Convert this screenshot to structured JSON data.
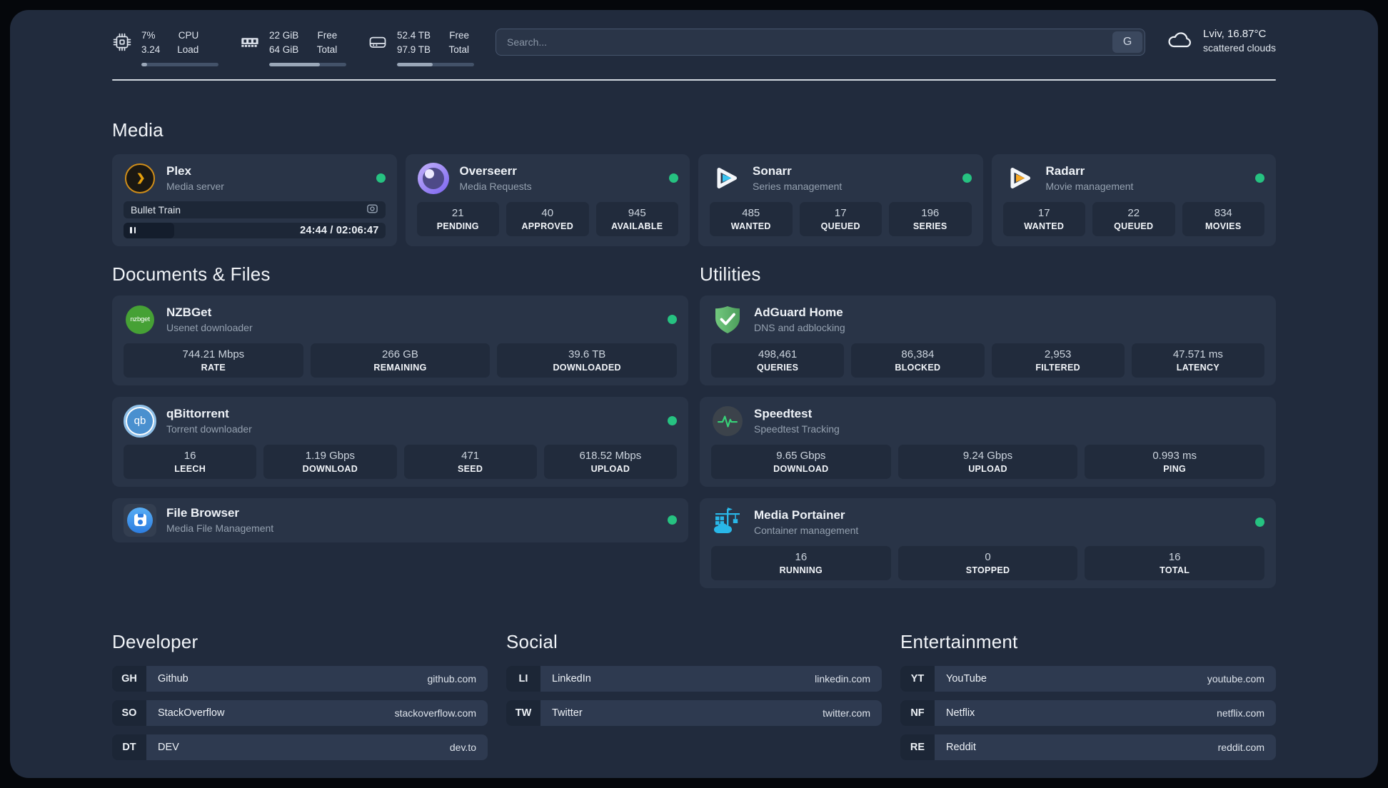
{
  "header": {
    "resources": [
      {
        "icon": "cpu-icon",
        "values": [
          "7%",
          "3.24"
        ],
        "labels": [
          "CPU",
          "Load"
        ],
        "progress_pct": 7
      },
      {
        "icon": "memory-icon",
        "values": [
          "22 GiB",
          "64 GiB"
        ],
        "labels": [
          "Free",
          "Total"
        ],
        "progress_pct": 66
      },
      {
        "icon": "disk-icon",
        "values": [
          "52.4 TB",
          "97.9 TB"
        ],
        "labels": [
          "Free",
          "Total"
        ],
        "progress_pct": 46
      }
    ],
    "search": {
      "placeholder": "Search...",
      "button_label": "G"
    },
    "weather": {
      "location": "Lviv, 16.87°C",
      "condition": "scattered clouds"
    }
  },
  "sections": {
    "media": {
      "title": "Media",
      "apps": [
        {
          "name": "Plex",
          "desc": "Media server",
          "now_playing": "Bullet Train",
          "time": "24:44 / 02:06:47",
          "progress_pct": 19.5
        },
        {
          "name": "Overseerr",
          "desc": "Media Requests",
          "stats": [
            {
              "value": "21",
              "label": "PENDING"
            },
            {
              "value": "40",
              "label": "APPROVED"
            },
            {
              "value": "945",
              "label": "AVAILABLE"
            }
          ]
        },
        {
          "name": "Sonarr",
          "desc": "Series management",
          "stats": [
            {
              "value": "485",
              "label": "WANTED"
            },
            {
              "value": "17",
              "label": "QUEUED"
            },
            {
              "value": "196",
              "label": "SERIES"
            }
          ]
        },
        {
          "name": "Radarr",
          "desc": "Movie management",
          "stats": [
            {
              "value": "17",
              "label": "WANTED"
            },
            {
              "value": "22",
              "label": "QUEUED"
            },
            {
              "value": "834",
              "label": "MOVIES"
            }
          ]
        }
      ]
    },
    "documents": {
      "title": "Documents & Files",
      "apps": [
        {
          "name": "NZBGet",
          "desc": "Usenet downloader",
          "logo_text": "nzbget",
          "stats": [
            {
              "value": "744.21 Mbps",
              "label": "RATE"
            },
            {
              "value": "266 GB",
              "label": "REMAINING"
            },
            {
              "value": "39.6 TB",
              "label": "DOWNLOADED"
            }
          ]
        },
        {
          "name": "qBittorrent",
          "desc": "Torrent downloader",
          "logo_text": "qb",
          "stats": [
            {
              "value": "16",
              "label": "LEECH"
            },
            {
              "value": "1.19 Gbps",
              "label": "DOWNLOAD"
            },
            {
              "value": "471",
              "label": "SEED"
            },
            {
              "value": "618.52 Mbps",
              "label": "UPLOAD"
            }
          ]
        },
        {
          "name": "File Browser",
          "desc": "Media File Management"
        }
      ]
    },
    "utilities": {
      "title": "Utilities",
      "apps": [
        {
          "name": "AdGuard Home",
          "desc": "DNS and adblocking",
          "stats": [
            {
              "value": "498,461",
              "label": "QUERIES"
            },
            {
              "value": "86,384",
              "label": "BLOCKED"
            },
            {
              "value": "2,953",
              "label": "FILTERED"
            },
            {
              "value": "47.571 ms",
              "label": "LATENCY"
            }
          ]
        },
        {
          "name": "Speedtest",
          "desc": "Speedtest Tracking",
          "stats": [
            {
              "value": "9.65 Gbps",
              "label": "DOWNLOAD"
            },
            {
              "value": "9.24 Gbps",
              "label": "UPLOAD"
            },
            {
              "value": "0.993 ms",
              "label": "PING"
            }
          ]
        },
        {
          "name": "Media Portainer",
          "desc": "Container management",
          "stats": [
            {
              "value": "16",
              "label": "RUNNING"
            },
            {
              "value": "0",
              "label": "STOPPED"
            },
            {
              "value": "16",
              "label": "TOTAL"
            }
          ]
        }
      ]
    },
    "links": [
      {
        "title": "Developer",
        "items": [
          {
            "abbr": "GH",
            "name": "Github",
            "url": "github.com"
          },
          {
            "abbr": "SO",
            "name": "StackOverflow",
            "url": "stackoverflow.com"
          },
          {
            "abbr": "DT",
            "name": "DEV",
            "url": "dev.to"
          }
        ]
      },
      {
        "title": "Social",
        "items": [
          {
            "abbr": "LI",
            "name": "LinkedIn",
            "url": "linkedin.com"
          },
          {
            "abbr": "TW",
            "name": "Twitter",
            "url": "twitter.com"
          }
        ]
      },
      {
        "title": "Entertainment",
        "items": [
          {
            "abbr": "YT",
            "name": "YouTube",
            "url": "youtube.com"
          },
          {
            "abbr": "NF",
            "name": "Netflix",
            "url": "netflix.com"
          },
          {
            "abbr": "RE",
            "name": "Reddit",
            "url": "reddit.com"
          }
        ]
      }
    ]
  },
  "colors": {
    "status_online": "#26c281",
    "plex_accent": "#e5a00d",
    "sonarr_accent": "#36c3f1",
    "radarr_accent": "#f7a823",
    "nzbget_accent": "#46a135",
    "qbittorrent_accent": "#4a90cf",
    "filebrowser_accent": "#2d7de0",
    "adguard_accent": "#5fba6c",
    "speedtest_accent": "#37d278",
    "portainer_accent": "#29b7e8"
  }
}
